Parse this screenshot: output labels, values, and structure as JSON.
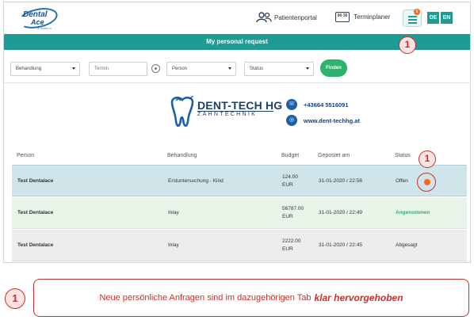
{
  "logo": {
    "line1": "Dental",
    "line2": "Ace",
    "line3": "a Vecteon"
  },
  "header": {
    "patient_portal": "Patientenportal",
    "appointment_planner": "Terminplaner",
    "calendar_icon_text": "06·30",
    "menu_badge": "1",
    "lang_de": "DE",
    "lang_en": "EN"
  },
  "page_title": "My personal request",
  "filters": {
    "treatment": "Behandlung",
    "appointment": "Termin",
    "person": "Person",
    "status": "Status",
    "find_label": "Finden"
  },
  "brand": {
    "name": "DENT-TECH HG",
    "sub": "ZAHNTECHNIK",
    "phone": "+43664 5516091",
    "website": "www.dent-techhg.at"
  },
  "table": {
    "headers": [
      "Person",
      "Behandlung",
      "Budget",
      "Gepostet am",
      "Status"
    ],
    "rows": [
      {
        "person": "Test Dentalace",
        "treatment": "Erstuntersuchung - Kind",
        "budget_amount": "124.00",
        "budget_currency": "EUR",
        "posted": "31-01-2020 / 22:56",
        "status": "Offen"
      },
      {
        "person": "Test Dentalace",
        "treatment": "Inlay",
        "budget_amount": "56787.00",
        "budget_currency": "EUR",
        "posted": "31-01-2020 / 22:49",
        "status": "Angenommen"
      },
      {
        "person": "Test Dentalace",
        "treatment": "Inlay",
        "budget_amount": "2222.00",
        "budget_currency": "EUR",
        "posted": "31-01-2020 / 22:45",
        "status": "Abgesagt"
      }
    ]
  },
  "callouts": {
    "marker": "1"
  },
  "note": {
    "text": "Neue persönliche Anfragen sind im dazugehörigen Tab",
    "emphasis": "klar hervorgehoben"
  },
  "colors": {
    "teal": "#1e9b95",
    "accepted_green": "#2db36e",
    "open_orange": "#f26b1d",
    "callout_red": "#c9302c"
  }
}
